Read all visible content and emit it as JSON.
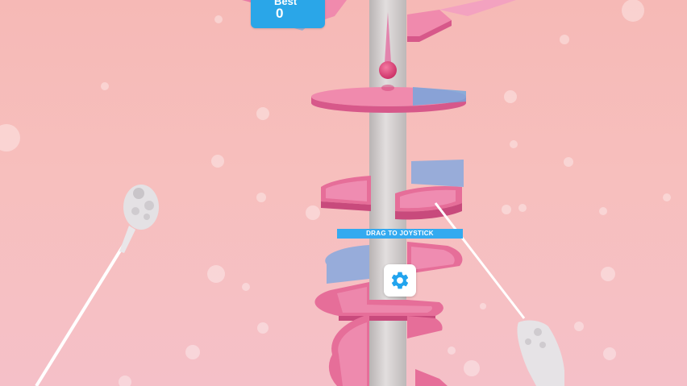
{
  "hud": {
    "best_label": "Best",
    "best_value": "0"
  },
  "joystick_hint": "DRAG TO JOYSTICK",
  "settings": {
    "icon": "gear-icon"
  },
  "colors": {
    "background": "#f6b9b6",
    "platform_pink": "#e66e99",
    "platform_light": "#f6a6c4",
    "danger_segment": "#8fb3e3",
    "ball": "#e0457a",
    "pillar": "#d0cccc",
    "hud_blue": "#2aa6e8",
    "gear_blue": "#22a4ee"
  },
  "controllers": [
    "left-vr-controller",
    "right-vr-controller"
  ]
}
